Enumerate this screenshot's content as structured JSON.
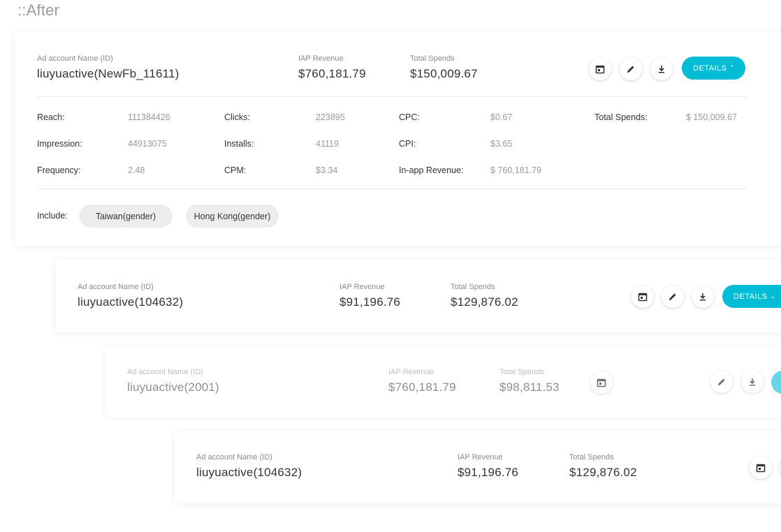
{
  "page": {
    "heading": "::After"
  },
  "cards": [
    {
      "name_label": "Ad account Name (ID)",
      "name_value": "liuyuactive(NewFb_11611)",
      "iap_label": "IAP Revenue",
      "iap_value": "$760,181.79",
      "spend_label": "Total Spends",
      "spend_value": "$150,009.67",
      "details_label": "DETAILS",
      "details_chevron": "^",
      "stats": {
        "reach_label": "Reach:",
        "reach_value": "111384426",
        "impression_label": "Impression:",
        "impression_value": "44913075",
        "frequency_label": "Frequency:",
        "frequency_value": "2.48",
        "clicks_label": "Clicks:",
        "clicks_value": "223895",
        "installs_label": "Installs:",
        "installs_value": "41119",
        "cpm_label": "CPM:",
        "cpm_value": "$3.34",
        "cpc_label": "CPC:",
        "cpc_value": "$0.67",
        "cpi_label": "CPI:",
        "cpi_value": "$3.65",
        "inapp_label": "In-app Revenue:",
        "inapp_value": "$ 760,181.79",
        "total_spends_label": "Total Spends:",
        "total_spends_value": "$ 150,009.67"
      },
      "include_label": "Include:",
      "include_chips": [
        "Taiwan(gender)",
        "Hong Kong(gender)"
      ]
    },
    {
      "name_label": "Ad account Name (ID)",
      "name_value": "liuyuactive(104632)",
      "iap_label": "IAP Revenue",
      "iap_value": "$91,196.76",
      "spend_label": "Total Spends",
      "spend_value": "$129,876.02",
      "details_label": "DETAILS",
      "details_chevron": "v"
    },
    {
      "name_label": "Ad account Name (ID)",
      "name_value": "liuyuactive(2001)",
      "iap_label": "IAP Revenue",
      "iap_value": "$760,181.79",
      "spend_label": "Total Spends",
      "spend_value": "$98,811.53"
    },
    {
      "name_label": "Ad account Name (ID)",
      "name_value": "liuyuactive(104632)",
      "iap_label": "IAP Revenue",
      "iap_value": "$91,196.76",
      "spend_label": "Total Spends",
      "spend_value": "$129,876.02"
    }
  ],
  "icons": {
    "calendar": "calendar-icon",
    "edit": "pencil-icon",
    "download": "download-icon"
  },
  "colors": {
    "accent": "#00bcd4",
    "chip_bg": "#ededed"
  }
}
